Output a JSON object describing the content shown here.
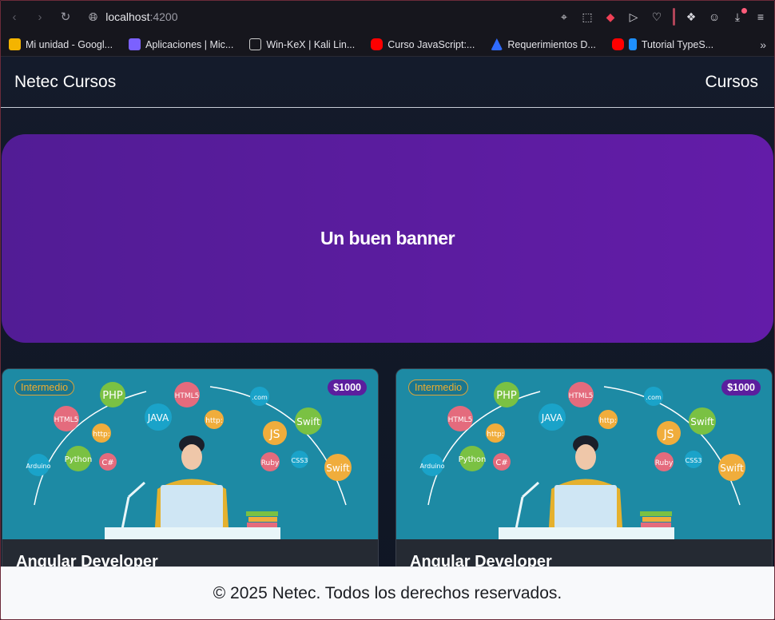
{
  "browser": {
    "url_host": "localhost",
    "url_port": ":4200",
    "bookmarks": [
      {
        "label": "Mi unidad - Googl...",
        "color": "#f4b400"
      },
      {
        "label": "Aplicaciones | Mic...",
        "color": "#7b61ff"
      },
      {
        "label": "Win-KeX | Kali Lin...",
        "color": "#e6e6ea"
      },
      {
        "label": "Curso JavaScript:...",
        "color": "#ff0000"
      },
      {
        "label": "Requerimientos D...",
        "color": "#2f6bff"
      },
      {
        "label": "Tutorial TypeS...",
        "color": "#1e90ff"
      }
    ]
  },
  "site": {
    "brand": "Netec Cursos",
    "nav_link": "Cursos",
    "banner": "Un buen banner",
    "cards": [
      {
        "level": "Intermedio",
        "price": "$1000",
        "title": "Angular Developer"
      },
      {
        "level": "Intermedio",
        "price": "$1000",
        "title": "Angular Developer"
      }
    ],
    "footer": "© 2025 Netec. Todos los derechos reservados."
  }
}
